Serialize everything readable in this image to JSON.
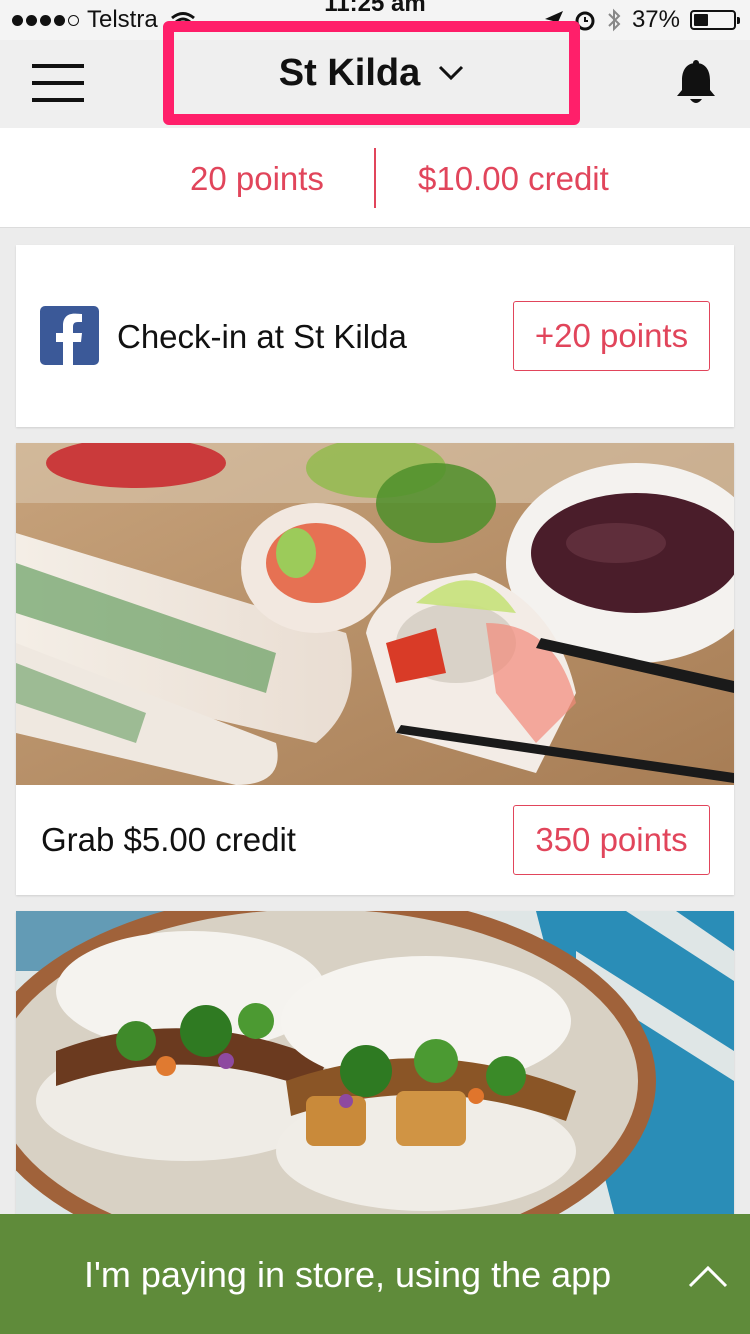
{
  "status_bar": {
    "carrier": "Telstra",
    "time": "11:25 am",
    "battery": "37%",
    "battery_level": 0.37
  },
  "header": {
    "location": "St Kilda",
    "menu_icon": "hamburger-menu-icon",
    "notification_icon": "bell-icon"
  },
  "balance": {
    "points": "20 points",
    "credit": "$10.00 credit"
  },
  "checkin_card": {
    "label": "Check-in at St Kilda",
    "action": "+20 points",
    "icon": "facebook-icon"
  },
  "rewards": [
    {
      "label": "Grab $5.00 credit",
      "action": "350 points"
    }
  ],
  "pay_bar": {
    "label": "I'm paying in store, using the app"
  },
  "colors": {
    "accent": "#e1455b",
    "highlight_border": "#ff1f6a",
    "pay_bar": "#5f8b3a",
    "facebook": "#3b5998"
  }
}
